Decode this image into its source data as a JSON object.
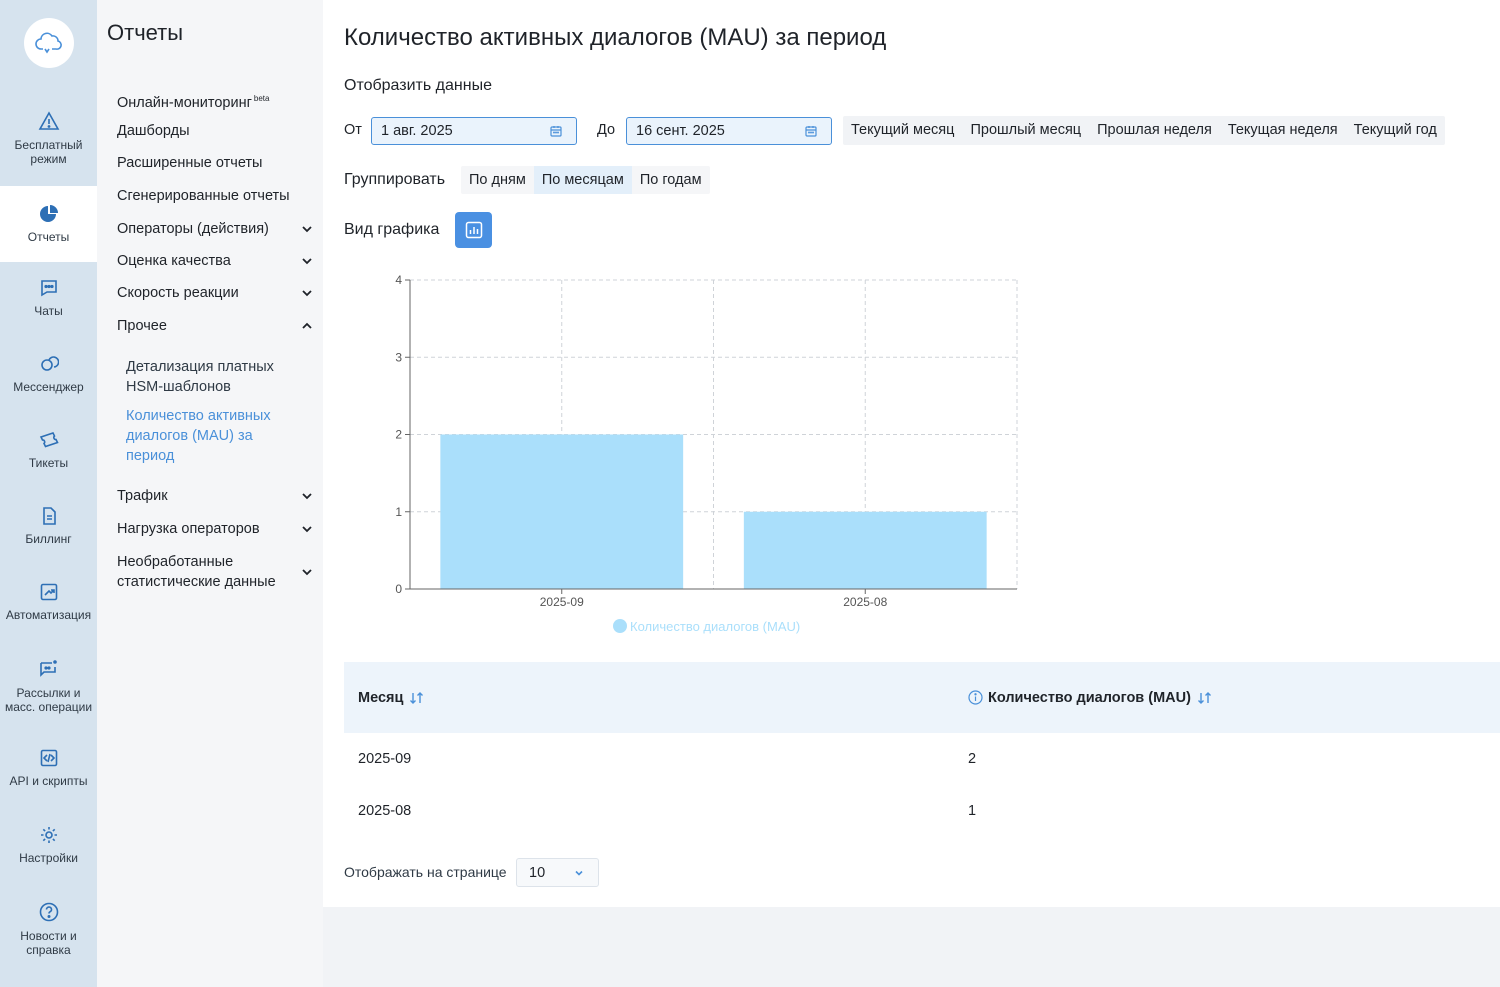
{
  "rail": {
    "items": [
      {
        "label": "Бесплатный режим",
        "icon": "warning-icon"
      },
      {
        "label": "Отчеты",
        "icon": "pie-chart-icon",
        "active": true
      },
      {
        "label": "Чаты",
        "icon": "chat-icon"
      },
      {
        "label": "Мессенджер",
        "icon": "messenger-icon"
      },
      {
        "label": "Тикеты",
        "icon": "ticket-icon"
      },
      {
        "label": "Биллинг",
        "icon": "document-icon"
      },
      {
        "label": "Автоматизация",
        "icon": "trend-icon"
      },
      {
        "label": "Рассылки и масс. операции",
        "icon": "broadcast-icon"
      },
      {
        "label": "API и скрипты",
        "icon": "code-icon"
      },
      {
        "label": "Настройки",
        "icon": "gear-icon"
      },
      {
        "label": "Новости и справка",
        "icon": "help-icon"
      }
    ]
  },
  "menu": {
    "title": "Отчеты",
    "items": {
      "online": "Онлайн-мониторинг",
      "online_badge": "beta",
      "dashboards": "Дашборды",
      "extended": "Расширенные отчеты",
      "generated": "Сгенерированные отчеты",
      "operators": "Операторы (действия)",
      "quality": "Оценка качества",
      "speed": "Скорость реакции",
      "other": "Прочее",
      "traffic": "Трафик",
      "load": "Нагрузка операторов",
      "raw": "Необработанные статистические данные"
    },
    "sub": {
      "hsm": "Детализация платных HSM-шаблонов",
      "mau": "Количество активных диалогов (MAU) за период"
    }
  },
  "main": {
    "title": "Количество активных диалогов (MAU) за период",
    "show_data": "Отобразить данные",
    "from_label": "От",
    "from_value": "1 авг. 2025",
    "to_label": "До",
    "to_value": "16 сент. 2025",
    "presets": [
      "Текущий месяц",
      "Прошлый месяц",
      "Прошлая неделя",
      "Текущая неделя",
      "Текущий год"
    ],
    "group_label": "Группировать",
    "group_tabs": [
      "По дням",
      "По месяцам",
      "По годам"
    ],
    "chart_view_label": "Вид графика",
    "accent": "#4a90e2"
  },
  "chart_data": {
    "type": "bar",
    "categories": [
      "2025-09",
      "2025-08"
    ],
    "series": [
      {
        "name": "Количество диалогов (MAU)",
        "values": [
          2,
          1
        ],
        "color": "#aadffb"
      }
    ],
    "yticks": [
      0,
      1,
      2,
      3,
      4
    ],
    "ylim": [
      0,
      4
    ],
    "grid": true,
    "legend": "bottom"
  },
  "table": {
    "col1": "Месяц",
    "col2": "Количество диалогов (MAU)",
    "rows": [
      {
        "month": "2025-09",
        "count": "2"
      },
      {
        "month": "2025-08",
        "count": "1"
      }
    ]
  },
  "pagination": {
    "label": "Отображать на странице",
    "value": "10"
  }
}
